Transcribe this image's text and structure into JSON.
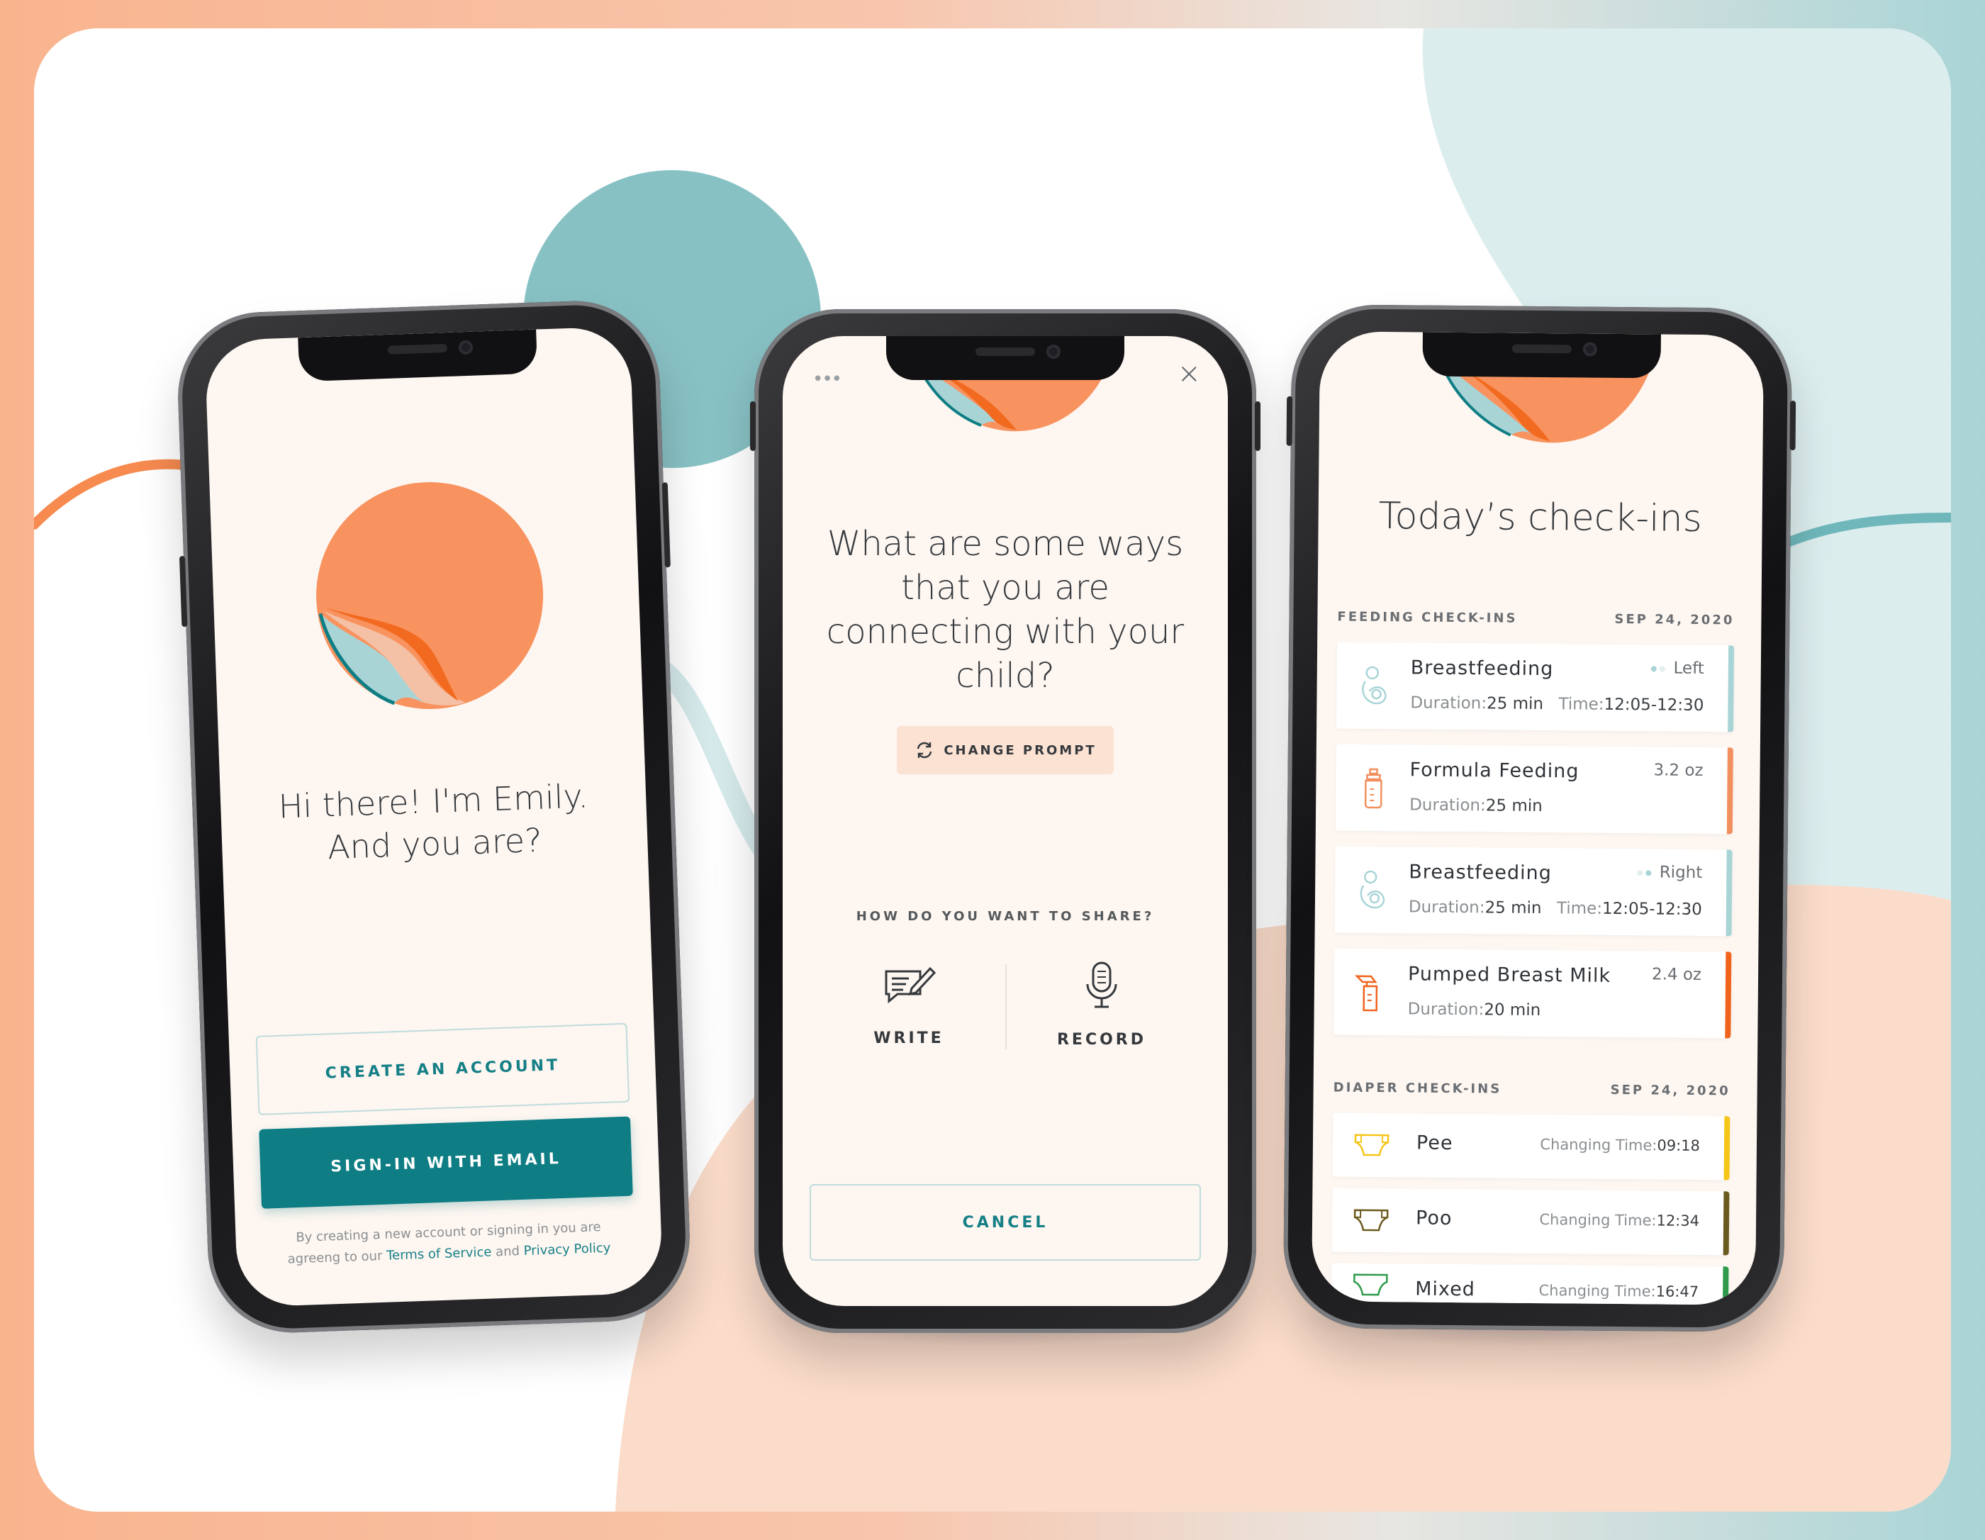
{
  "colors": {
    "brand_orange": "#f8935f",
    "brand_teal": "#0e7d84",
    "screen_bg": "#fdf6f1",
    "bar_breastfeeding": "#a9d4d6",
    "bar_formula": "#f28f5e",
    "bar_pumped": "#f0631c",
    "bar_pee": "#f5c518",
    "bar_poo": "#6b5a1e",
    "bar_mixed": "#2e9a4a"
  },
  "phone1": {
    "logo_icon": "peeled-sticker-logo",
    "greeting_line1": "Hi there! I'm Emily.",
    "greeting_line2": "And you are?",
    "create_account_label": "CREATE AN ACCOUNT",
    "signin_label": "SIGN-IN WITH EMAIL",
    "legal_text1": "By creating a new account or signing in you are",
    "legal_text2": "agreeng to our",
    "terms_link": "Terms of Service",
    "legal_and": "and",
    "privacy_link": "Privacy Policy"
  },
  "phone2": {
    "menu_dots": "•••",
    "close_icon": "×",
    "prompt_line1": "What are some ways",
    "prompt_line2": "that you are",
    "prompt_line3": "connecting with your",
    "prompt_line4": "child?",
    "change_prompt_label": "CHANGE PROMPT",
    "share_question": "HOW DO YOU WANT TO SHARE?",
    "write_label": "WRITE",
    "record_label": "RECORD",
    "cancel_label": "CANCEL"
  },
  "phone3": {
    "title": "Today’s check-ins",
    "feeding_header": "FEEDING CHECK-INS",
    "feeding_date": "SEP 24, 2020",
    "feeding": [
      {
        "name": "Breastfeeding",
        "side": "Left",
        "duration_label": "Duration:",
        "duration": "25 min",
        "time_label": "Time:",
        "time": "12:05-12:30",
        "icon": "breastfeeding-icon"
      },
      {
        "name": "Formula Feeding",
        "amount": "3.2 oz",
        "duration_label": "Duration:",
        "duration": "25 min",
        "icon": "bottle-icon"
      },
      {
        "name": "Breastfeeding",
        "side": "Right",
        "duration_label": "Duration:",
        "duration": "25 min",
        "time_label": "Time:",
        "time": "12:05-12:30",
        "icon": "breastfeeding-icon"
      },
      {
        "name": "Pumped Breast Milk",
        "amount": "2.4 oz",
        "duration_label": "Duration:",
        "duration": "20 min",
        "icon": "breast-pump-icon"
      }
    ],
    "diaper_header": "DIAPER CHECK-INS",
    "diaper_date": "SEP 24, 2020",
    "diaper": [
      {
        "name": "Pee",
        "time_label": "Changing Time:",
        "time": "09:18",
        "icon": "diaper-icon"
      },
      {
        "name": "Poo",
        "time_label": "Changing Time:",
        "time": "12:34",
        "icon": "diaper-icon"
      },
      {
        "name": "Mixed",
        "time_label": "Changing Time:",
        "time": "16:47",
        "icon": "diaper-icon"
      }
    ]
  }
}
